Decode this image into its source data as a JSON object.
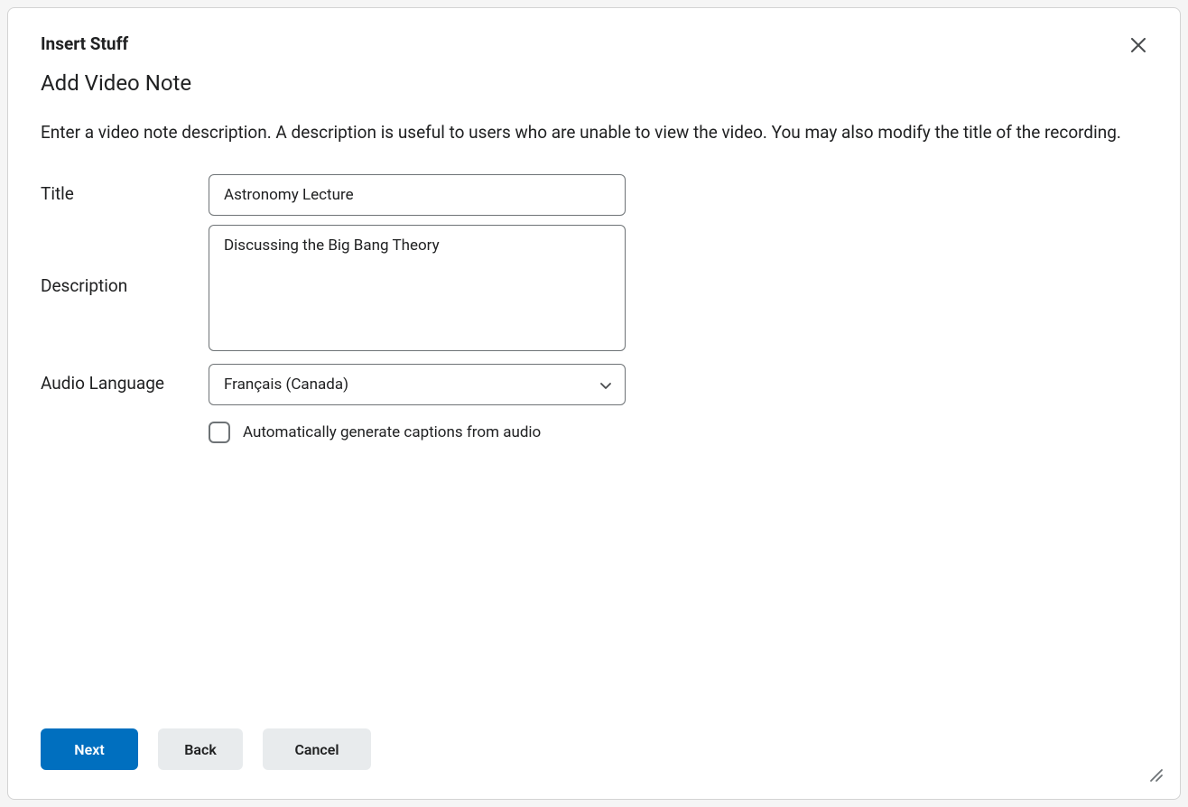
{
  "modal": {
    "title": "Insert Stuff",
    "page_title": "Add Video Note",
    "description": "Enter a video note description. A description is useful to users who are unable to view the video. You may also modify the title of the recording."
  },
  "form": {
    "title_label": "Title",
    "title_value": "Astronomy Lecture",
    "description_label": "Description",
    "description_value": "Discussing the Big Bang Theory",
    "audio_language_label": "Audio Language",
    "audio_language_value": "Français (Canada)",
    "captions_checkbox_label": "Automatically generate captions from audio"
  },
  "buttons": {
    "next": "Next",
    "back": "Back",
    "cancel": "Cancel"
  }
}
